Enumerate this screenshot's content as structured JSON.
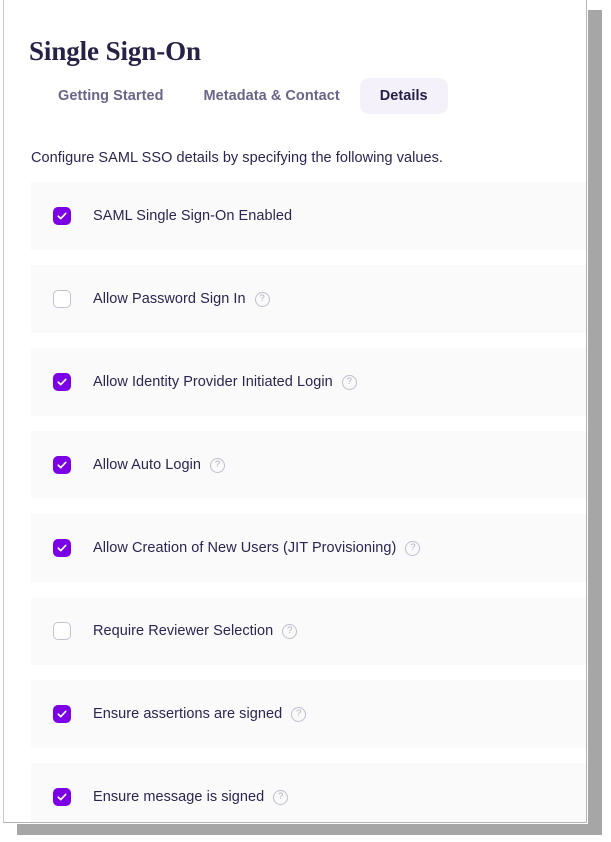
{
  "page": {
    "title": "Single Sign-On"
  },
  "tabs": [
    {
      "label": "Getting Started",
      "active": false
    },
    {
      "label": "Metadata & Contact",
      "active": false
    },
    {
      "label": "Details",
      "active": true
    }
  ],
  "description": "Configure SAML SSO details by specifying the following values.",
  "settings": [
    {
      "label": "SAML Single Sign-On Enabled",
      "checked": true,
      "help": false,
      "help_glyph": ""
    },
    {
      "label": "Allow Password Sign In",
      "checked": false,
      "help": true,
      "help_glyph": "?"
    },
    {
      "label": "Allow Identity Provider Initiated Login",
      "checked": true,
      "help": true,
      "help_glyph": "?"
    },
    {
      "label": "Allow Auto Login",
      "checked": true,
      "help": true,
      "help_glyph": "?"
    },
    {
      "label": "Allow Creation of New Users (JIT Provisioning)",
      "checked": true,
      "help": true,
      "help_glyph": "?"
    },
    {
      "label": "Require Reviewer Selection",
      "checked": false,
      "help": true,
      "help_glyph": "?"
    },
    {
      "label": "Ensure assertions are signed",
      "checked": true,
      "help": true,
      "help_glyph": "?"
    },
    {
      "label": "Ensure message is signed",
      "checked": true,
      "help": true,
      "help_glyph": "?"
    }
  ],
  "colors": {
    "accent_purple": "#7b00e6",
    "title_navy": "#262145",
    "tab_inactive": "#6a6488",
    "tab_active_bg": "#f5f1fb",
    "row_bg": "#fafafa",
    "help_border": "#c0bece",
    "checkbox_border": "#c4c2cf"
  }
}
